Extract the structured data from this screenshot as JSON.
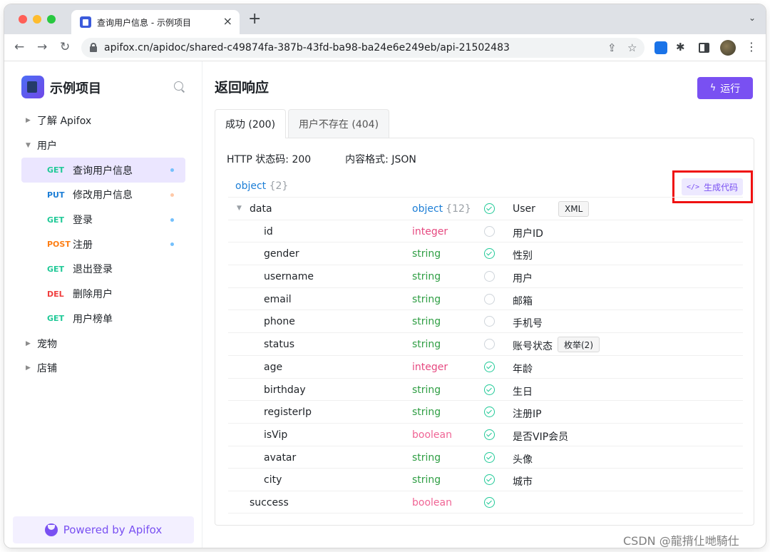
{
  "browser": {
    "tab_title": "查询用户信息 - 示例项目",
    "tab_close": "×",
    "new_tab": "+",
    "tab_dropdown": "⌄",
    "url": "apifox.cn/apidoc/shared-c49874fa-387b-43fd-ba98-ba24e6e249eb/api-21502483",
    "nav": {
      "back": "←",
      "forward": "→",
      "reload": "↻"
    },
    "share_icon": "⇪",
    "star_icon": "☆",
    "menu_icon": "⋮",
    "puzzle_icon": "✱"
  },
  "sidebar": {
    "project_name": "示例项目",
    "items": [
      {
        "label": "了解 Apifox",
        "caret": "▶"
      },
      {
        "label": "用户",
        "caret": "▼"
      },
      {
        "label": "宠物",
        "caret": "▶"
      },
      {
        "label": "店铺",
        "caret": "▶"
      }
    ],
    "apis": [
      {
        "method": "GET",
        "label": "查询用户信息",
        "dot_color": "#74c0fc"
      },
      {
        "method": "PUT",
        "label": "修改用户信息",
        "dot_color": "#ffc9a8"
      },
      {
        "method": "GET",
        "label": "登录",
        "dot_color": "#74c0fc"
      },
      {
        "method": "POST",
        "label": "注册",
        "dot_color": "#74c0fc"
      },
      {
        "method": "GET",
        "label": "退出登录",
        "dot_color": null
      },
      {
        "method": "DEL",
        "label": "删除用户",
        "dot_color": null
      },
      {
        "method": "GET",
        "label": "用户榜单",
        "dot_color": null
      }
    ],
    "powered_by": "Powered by Apifox"
  },
  "main": {
    "title": "返回响应",
    "run_label": "运行",
    "run_icon": "ϟ",
    "tabs": [
      "成功 (200)",
      "用户不存在 (404)"
    ],
    "http_status": "HTTP 状态码: 200",
    "content_type": "内容格式: JSON",
    "root_type": "object",
    "root_count": "{2}",
    "generate_code": "生成代码",
    "code_icon": "</>",
    "expand_caret": "▼",
    "fields": [
      {
        "name": "data",
        "type": "object",
        "count": "{12}",
        "required": true,
        "desc": "User",
        "tag": "XML",
        "indent": 1
      },
      {
        "name": "id",
        "type": "integer",
        "required": false,
        "desc": "用户ID",
        "indent": 2
      },
      {
        "name": "gender",
        "type": "string",
        "required": true,
        "desc": "性别",
        "indent": 2
      },
      {
        "name": "username",
        "type": "string",
        "required": false,
        "desc": "用户",
        "indent": 2
      },
      {
        "name": "email",
        "type": "string",
        "required": false,
        "desc": "邮箱",
        "indent": 2
      },
      {
        "name": "phone",
        "type": "string",
        "required": false,
        "desc": "手机号",
        "indent": 2
      },
      {
        "name": "status",
        "type": "string",
        "required": false,
        "desc": "账号状态",
        "tag": "枚举(2)",
        "indent": 2
      },
      {
        "name": "age",
        "type": "integer",
        "required": true,
        "desc": "年龄",
        "indent": 2
      },
      {
        "name": "birthday",
        "type": "string",
        "required": true,
        "desc": "生日",
        "indent": 2
      },
      {
        "name": "registerIp",
        "type": "string",
        "required": true,
        "desc": "注册IP",
        "indent": 2
      },
      {
        "name": "isVip",
        "type": "boolean",
        "required": true,
        "desc": "是否VIP会员",
        "indent": 2
      },
      {
        "name": "avatar",
        "type": "string",
        "required": true,
        "desc": "头像",
        "indent": 2
      },
      {
        "name": "city",
        "type": "string",
        "required": true,
        "desc": "城市",
        "indent": 2
      },
      {
        "name": "success",
        "type": "boolean",
        "required": true,
        "desc": "",
        "indent": 1
      }
    ]
  },
  "watermark": "CSDN @龍揹仩哋騎仕",
  "colors": {
    "accent": "#7950f2",
    "highlight": "#ef1111",
    "get": "#20c997",
    "put": "#1c7ed6",
    "post": "#fd7e14",
    "del": "#f03e3e"
  }
}
